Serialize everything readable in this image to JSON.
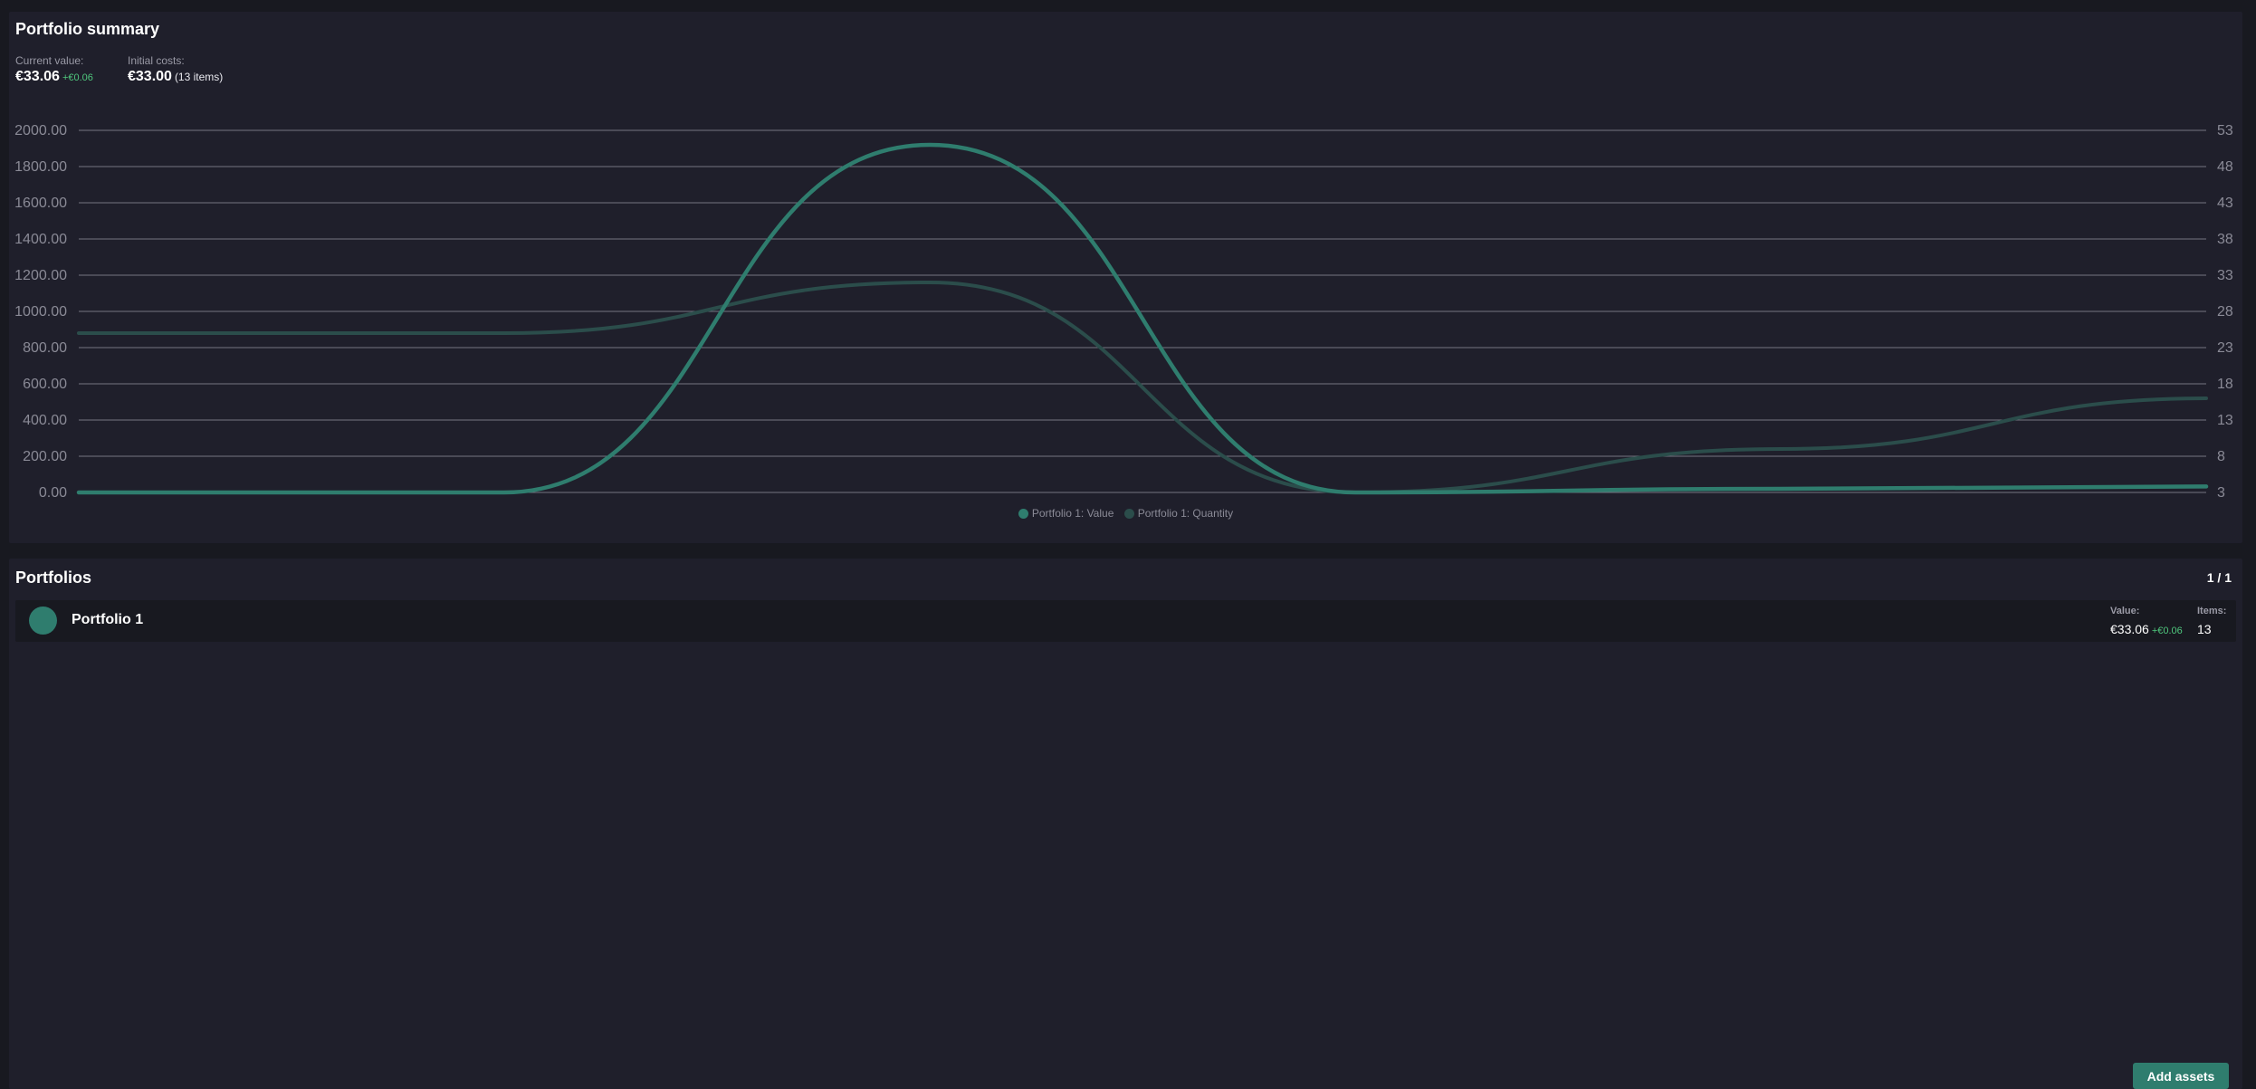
{
  "summary": {
    "title": "Portfolio summary",
    "current_value_label": "Current value:",
    "current_value": "€33.06",
    "current_delta": "+€0.06",
    "initial_costs_label": "Initial costs:",
    "initial_costs": "€33.00",
    "initial_items_note": "(13 items)"
  },
  "colors": {
    "accent": "#2f7d6e",
    "quantity_line": "#2b4d4b",
    "positive": "#4fc77d",
    "grid": "#8a8a96"
  },
  "chart_data": {
    "type": "line",
    "x": [
      0,
      1,
      2,
      3,
      4,
      5
    ],
    "left_axis": {
      "ylim": [
        0,
        2000
      ],
      "ticks": [
        "0.00",
        "200.00",
        "400.00",
        "600.00",
        "800.00",
        "1000.00",
        "1200.00",
        "1400.00",
        "1600.00",
        "1800.00",
        "2000.00"
      ]
    },
    "right_axis": {
      "ylim": [
        3,
        53
      ],
      "ticks": [
        "3",
        "8",
        "13",
        "18",
        "23",
        "28",
        "33",
        "38",
        "43",
        "48",
        "53"
      ]
    },
    "grid": true,
    "legend_position": "bottom-center",
    "series": [
      {
        "name": "Portfolio 1: Value",
        "axis": "left",
        "values": [
          0,
          0,
          1920,
          0,
          20,
          33
        ]
      },
      {
        "name": "Portfolio 1: Quantity",
        "axis": "right",
        "values": [
          25,
          25,
          32,
          3,
          9,
          16
        ]
      }
    ]
  },
  "portfolios": {
    "title": "Portfolios",
    "page": "1 / 1",
    "items": [
      {
        "name": "Portfolio 1",
        "value_label": "Value:",
        "value": "€33.06",
        "delta": "+€0.06",
        "items_label": "Items:",
        "items": "13"
      }
    ],
    "add_button": "Add assets"
  }
}
